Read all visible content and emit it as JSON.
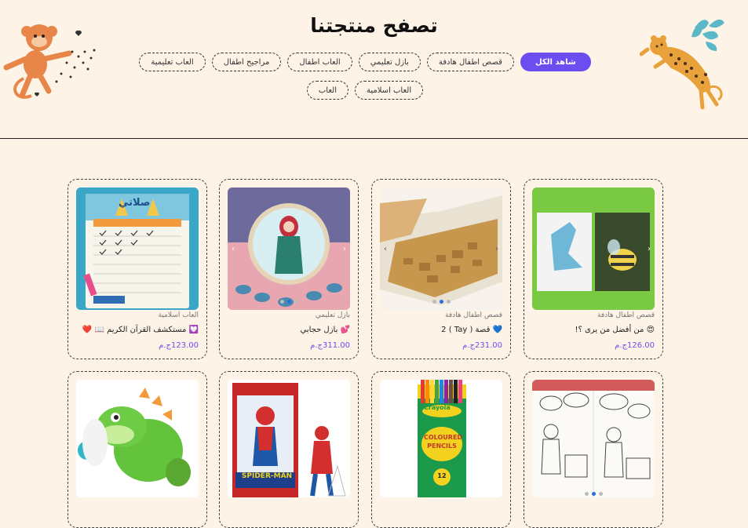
{
  "header": {
    "title": "تصفح منتجتنا",
    "filters": [
      {
        "label": "شاهد الكل",
        "active": true
      },
      {
        "label": "قصص اطفال هادفة",
        "active": false
      },
      {
        "label": "بازل تعليمي",
        "active": false
      },
      {
        "label": "العاب اطفال",
        "active": false
      },
      {
        "label": "مراجيح اطفال",
        "active": false
      },
      {
        "label": "العاب تعليمية",
        "active": false
      },
      {
        "label": "العاب اسلامية",
        "active": false
      },
      {
        "label": "العاب",
        "active": false
      }
    ]
  },
  "products": [
    {
      "category": "قصص اطفال هادفة",
      "name": "😍 من أفضل من يرى ؟!",
      "price": "126.00ج.م"
    },
    {
      "category": "قصص اطفال هادفة",
      "name": "💙 قصة ( Tay ) 2",
      "price": "231.00ج.م"
    },
    {
      "category": "بازل تعليمي",
      "name": "💕 بازل حجابي",
      "price": "311.00ج.م"
    },
    {
      "category": "العاب اسلامية",
      "name": "💟 مستكشف القرآن الكريم 📖 ❤️",
      "price": "123.00ج.م"
    }
  ],
  "image_labels": {
    "prayer_chart": "صلاتي",
    "pencils_brand": "Crayola",
    "pencils_text": "COLOURED PENCILS",
    "pencils_count": "12",
    "spiderman": "SPIDER-MAN"
  },
  "colors": {
    "accent": "#6c4df0",
    "background": "#fdf3e7"
  }
}
